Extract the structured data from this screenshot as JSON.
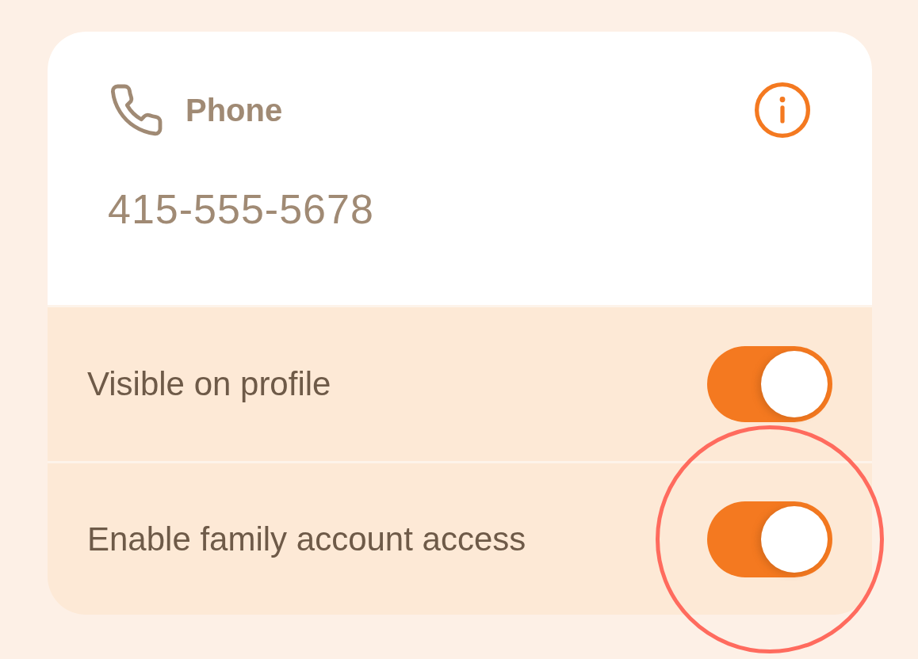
{
  "field": {
    "label": "Phone",
    "value": "415-555-5678"
  },
  "settings": [
    {
      "label": "Visible on profile",
      "on": true,
      "highlighted": false
    },
    {
      "label": "Enable family account access",
      "on": true,
      "highlighted": true
    }
  ]
}
